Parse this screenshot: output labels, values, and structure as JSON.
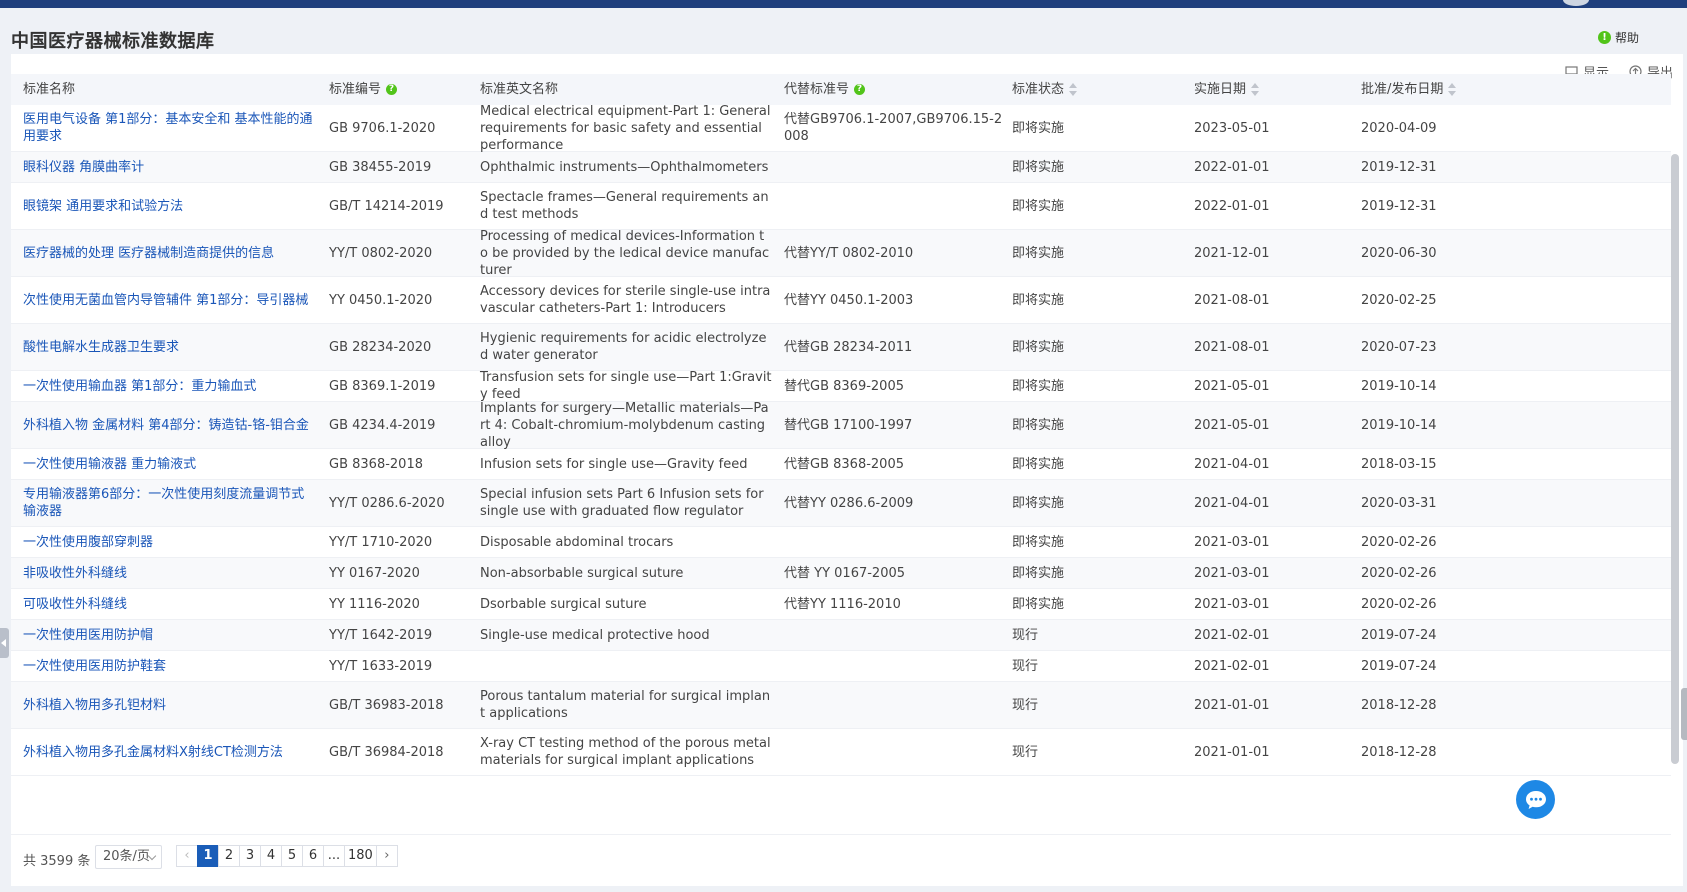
{
  "header": {
    "title": "中国医疗器械标准数据库",
    "help_label": "帮助"
  },
  "toolbar": {
    "display_label": "显示",
    "export_label": "导出"
  },
  "columns": [
    {
      "key": "name",
      "label": "标准名称"
    },
    {
      "key": "code",
      "label": "标准编号"
    },
    {
      "key": "en",
      "label": "标准英文名称"
    },
    {
      "key": "replace",
      "label": "代替标准号"
    },
    {
      "key": "status",
      "label": "标准状态"
    },
    {
      "key": "impl",
      "label": "实施日期"
    },
    {
      "key": "pub",
      "label": "批准/发布日期"
    }
  ],
  "rows": [
    {
      "name": "医用电气设备 第1部分：基本安全和 基本性能的通用要求",
      "code": "GB 9706.1-2020",
      "en": "Medical electrical equipment-Part 1: General requirements for basic safety and essential performance",
      "replace": "代替GB9706.1-2007,GB9706.15-2008",
      "status": "即将实施",
      "impl": "2023-05-01",
      "pub": "2020-04-09"
    },
    {
      "name": "眼科仪器 角膜曲率计",
      "code": "GB 38455-2019",
      "en": "Ophthalmic instruments—Ophthalmometers",
      "replace": "",
      "status": "即将实施",
      "impl": "2022-01-01",
      "pub": "2019-12-31"
    },
    {
      "name": "眼镜架 通用要求和试验方法",
      "code": "GB/T 14214-2019",
      "en": "Spectacle frames—General requirements and test methods",
      "replace": "",
      "status": "即将实施",
      "impl": "2022-01-01",
      "pub": "2019-12-31"
    },
    {
      "name": "医疗器械的处理 医疗器械制造商提供的信息",
      "code": "YY/T 0802-2020",
      "en": "Processing of medical devices-Information to be provided by the ledical device manufacturer",
      "replace": "代替YY/T 0802-2010",
      "status": "即将实施",
      "impl": "2021-12-01",
      "pub": "2020-06-30"
    },
    {
      "name": "次性使用无菌血管内导管辅件 第1部分：导引器械",
      "code": "YY 0450.1-2020",
      "en": "Accessory devices for sterile single-use intravascular catheters-Part 1: Introducers",
      "replace": "代替YY 0450.1-2003",
      "status": "即将实施",
      "impl": "2021-08-01",
      "pub": "2020-02-25"
    },
    {
      "name": "酸性电解水生成器卫生要求",
      "code": "GB 28234-2020",
      "en": "Hygienic requirements for acidic electrolyzed water generator",
      "replace": "代替GB 28234-2011",
      "status": "即将实施",
      "impl": "2021-08-01",
      "pub": "2020-07-23"
    },
    {
      "name": "一次性使用输血器 第1部分：重力输血式",
      "code": "GB 8369.1-2019",
      "en": "Transfusion sets for single use—Part 1:Gravity feed",
      "replace": "替代GB 8369-2005",
      "status": "即将实施",
      "impl": "2021-05-01",
      "pub": "2019-10-14"
    },
    {
      "name": "外科植入物 金属材料 第4部分：铸造钴-铬-钼合金",
      "code": "GB 4234.4-2019",
      "en": "Implants for surgery—Metallic materials—Part 4: Cobalt-chromium-molybdenum casting alloy",
      "replace": "替代GB 17100-1997",
      "status": "即将实施",
      "impl": "2021-05-01",
      "pub": "2019-10-14"
    },
    {
      "name": "一次性使用输液器 重力输液式",
      "code": "GB 8368-2018",
      "en": "Infusion sets for single use—Gravity feed",
      "replace": "代替GB 8368-2005",
      "status": "即将实施",
      "impl": "2021-04-01",
      "pub": "2018-03-15"
    },
    {
      "name": "专用输液器第6部分：一次性使用刻度流量调节式输液器",
      "code": "YY/T 0286.6-2020",
      "en": "Special infusion sets Part 6 Infusion sets for single use with graduated flow regulator",
      "replace": "代替YY 0286.6-2009",
      "status": "即将实施",
      "impl": "2021-04-01",
      "pub": "2020-03-31"
    },
    {
      "name": "一次性使用腹部穿刺器",
      "code": "YY/T 1710-2020",
      "en": "Disposable abdominal trocars",
      "replace": "",
      "status": "即将实施",
      "impl": "2021-03-01",
      "pub": "2020-02-26"
    },
    {
      "name": "非吸收性外科缝线",
      "code": "YY 0167-2020",
      "en": "Non-absorbable surgical suture",
      "replace": "代替 YY 0167-2005",
      "status": "即将实施",
      "impl": "2021-03-01",
      "pub": "2020-02-26"
    },
    {
      "name": "可吸收性外科缝线",
      "code": "YY 1116-2020",
      "en": "Dsorbable surgical suture",
      "replace": "代替YY 1116-2010",
      "status": "即将实施",
      "impl": "2021-03-01",
      "pub": "2020-02-26"
    },
    {
      "name": "一次性使用医用防护帽",
      "code": "YY/T 1642-2019",
      "en": "Single-use medical protective hood",
      "replace": "",
      "status": "现行",
      "impl": "2021-02-01",
      "pub": "2019-07-24"
    },
    {
      "name": "一次性使用医用防护鞋套",
      "code": "YY/T 1633-2019",
      "en": "",
      "replace": "",
      "status": "现行",
      "impl": "2021-02-01",
      "pub": "2019-07-24"
    },
    {
      "name": "外科植入物用多孔钽材料",
      "code": "GB/T 36983-2018",
      "en": "Porous tantalum material for surgical implant applications",
      "replace": "",
      "status": "现行",
      "impl": "2021-01-01",
      "pub": "2018-12-28"
    },
    {
      "name": "外科植入物用多孔金属材料X射线CT检测方法",
      "code": "GB/T 36984-2018",
      "en": "X-ray CT testing method of the porous metal materials for surgical implant applications",
      "replace": "",
      "status": "现行",
      "impl": "2021-01-01",
      "pub": "2018-12-28"
    }
  ],
  "pagination": {
    "total": "共 3599 条",
    "page_size": "20条/页",
    "pages": [
      "1",
      "2",
      "3",
      "4",
      "5",
      "6",
      "...",
      "180"
    ],
    "current": "1"
  }
}
